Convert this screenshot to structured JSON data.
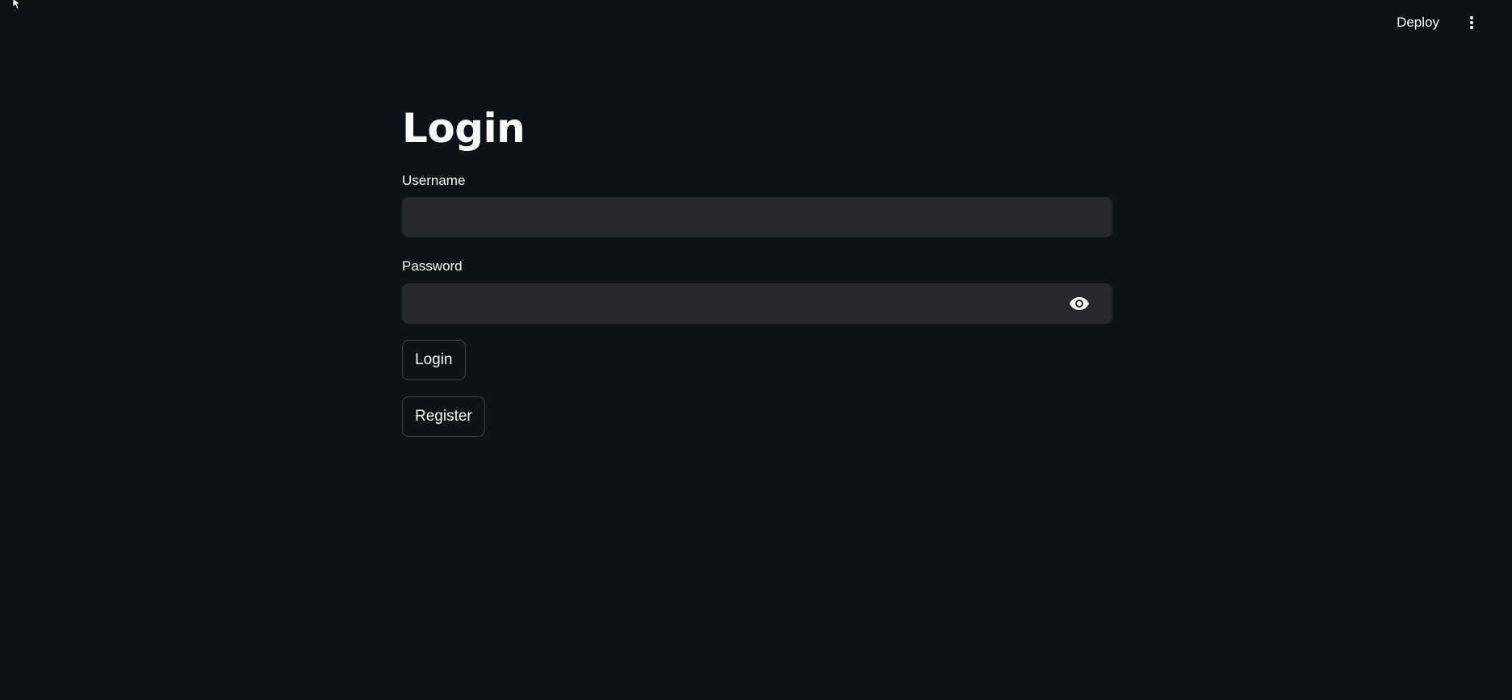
{
  "header": {
    "deploy_label": "Deploy",
    "menu_icon": "more-vertical-icon"
  },
  "main": {
    "title": "Login",
    "username": {
      "label": "Username",
      "value": "",
      "placeholder": ""
    },
    "password": {
      "label": "Password",
      "value": "",
      "placeholder": "",
      "toggle_icon": "eye-icon"
    },
    "login_button": "Login",
    "register_button": "Register"
  },
  "colors": {
    "background": "#0e1117",
    "input_background": "#262730",
    "text": "#fafafa"
  }
}
